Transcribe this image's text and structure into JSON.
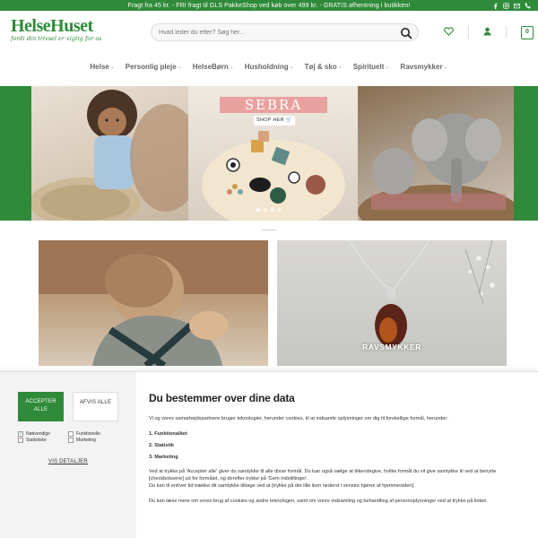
{
  "topbar": {
    "promo": "Fragt fra 45 kr. - FRI fragt til GLS PakkeShop ved køb over 499 kr. - GRATIS afhentning i butikken!",
    "social_icons": [
      "facebook-icon",
      "instagram-icon",
      "mail-icon",
      "phone-icon"
    ]
  },
  "header": {
    "logo_text": "HelseHuset",
    "tagline": "fordi din trivsel er vigtig for os",
    "search_placeholder": "Hvad leder du efter? Søg her...",
    "cart_count": "0"
  },
  "nav": {
    "items": [
      "Helse",
      "Personlig pleje",
      "HelseBørn",
      "Husholdning",
      "Tøj & sko",
      "Spirituelt",
      "Ravsmykker"
    ]
  },
  "hero": {
    "title": "SEBRA",
    "button": "SHOP HER",
    "slide_count": 4,
    "active_slide": 1
  },
  "tiles": {
    "left_label": "",
    "right_label": "RAVSMYKKER"
  },
  "cookie": {
    "accept": "ACCEPTER ALLE",
    "decline": "AFVIS ALLE",
    "checks": {
      "necessary": "Nødvendige",
      "statistics": "Statistiske",
      "functional": "Funktionelle",
      "marketing": "Marketing"
    },
    "details_link": "VIS DETALJER",
    "title": "Du bestemmer over dine data",
    "intro": "Vi og vores samarbejdspartnere bruger teknologier, herunder cookies, til at indsamle oplysninger om dig til forskellige formål, herunder:",
    "list": [
      "1. Funktionalitet",
      "2. Statistik",
      "3. Marketing"
    ],
    "para1": "Ved at trykke på 'Accepter alle' giver du samtykke til alle disse formål. Du kan også vælge at tilkendegive, hvilke formål du vil give samtykke til ved at benytte [checkboksene] ud for formålet, og derefter trykke på 'Gem indstillinger'.",
    "para2": "Du kan til enhver tid trække dit samtykke tilbage ved at [trykke på det lille ikon nederst i venstre hjørne af hjemmesiden].",
    "para3": "Du kan læse mere om vores brug af cookies og andre teknologier, samt om vores indsamling og behandling af personoplysninger ved at trykke på linket."
  },
  "colors": {
    "brand_green": "#2f8a3a",
    "sebra_pink": "#e8a2a0"
  }
}
